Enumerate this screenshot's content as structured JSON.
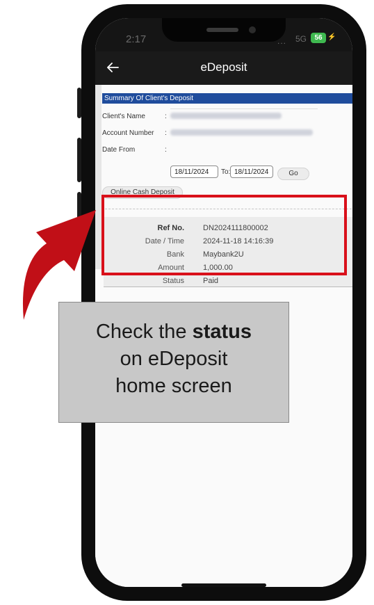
{
  "status_bar": {
    "time": "2:17",
    "signal": "...",
    "network": "5G",
    "battery": "56",
    "bolt": "⚡"
  },
  "header": {
    "back_icon": "arrow-left-icon",
    "title": "eDeposit"
  },
  "summary": {
    "title": "Summary Of Client's Deposit",
    "client_name_label": "Client's Name",
    "account_number_label": "Account Number",
    "date_from_label": "Date From",
    "colon": ":",
    "date_from_value": "18/11/2024",
    "to_label": "To:",
    "date_to_value": "18/11/2024",
    "go_label": "Go",
    "cash_deposit_label": "Online Cash Deposit"
  },
  "record": {
    "rows": [
      {
        "label": "Ref No.",
        "value": "DN2024111800002"
      },
      {
        "label": "Date / Time",
        "value": "2024-11-18 14:16:39"
      },
      {
        "label": "Bank",
        "value": "Maybank2U"
      },
      {
        "label": "Amount",
        "value": "1,000.00"
      },
      {
        "label": "Status",
        "value": "Paid"
      }
    ]
  },
  "callout": {
    "line1_prefix": "Check the ",
    "line1_bold": "status",
    "line2": "on eDeposit",
    "line3": "home screen"
  },
  "colors": {
    "summary_bar": "#1f4c9c",
    "highlight": "#d9101a",
    "arrow": "#c10f17",
    "callout_bg": "#c8c8c8",
    "battery": "#3fb950"
  }
}
